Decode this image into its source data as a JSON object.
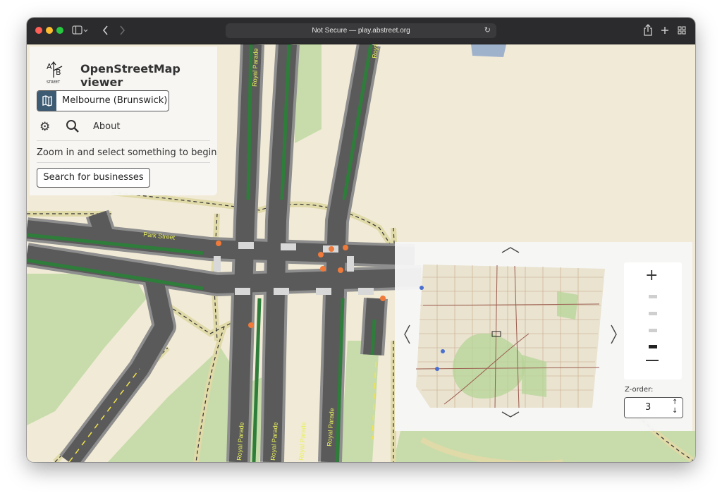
{
  "browser": {
    "url_text": "Not Secure — play.abstreet.org"
  },
  "app": {
    "logo_text_a": "A",
    "logo_text_b": "B",
    "logo_caption": "STREET",
    "title": "OpenStreetMap viewer",
    "map_button_label": "Melbourne (Brunswick)",
    "about_label": "About",
    "hint": "Zoom in and select something to begin",
    "search_businesses_label": "Search for businesses"
  },
  "map": {
    "street_labels": [
      "Park Street",
      "Royal Parade",
      "Royal Parade",
      "Royal Parade",
      "Royal Parade",
      "Royal Parade",
      "Royal Parade"
    ]
  },
  "minimap": {
    "zorder_label": "Z-order:",
    "zorder_value": "3",
    "zoom_level": 4,
    "zoom_levels_total": 5
  },
  "colors": {
    "background": "#f1ead6",
    "park": "#c7dcaa",
    "road": "#5a5a5a",
    "median": "#2f7d3b",
    "sidewalk": "#8e8e8e",
    "path_casing": "#e0d9a8",
    "map_button_icon_bg": "#3d5b73"
  }
}
